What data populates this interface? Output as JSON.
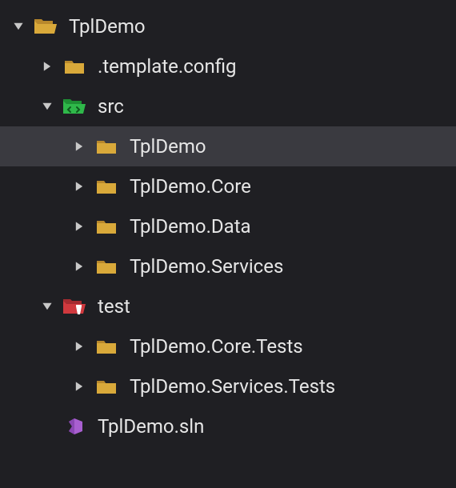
{
  "tree": {
    "root": {
      "label": "TplDemo",
      "icon": "folder-open",
      "expanded": true,
      "children": [
        {
          "label": ".template.config",
          "icon": "folder",
          "expanded": false
        },
        {
          "label": "src",
          "icon": "folder-src",
          "expanded": true,
          "children": [
            {
              "label": "TplDemo",
              "icon": "folder",
              "expanded": false,
              "selected": true
            },
            {
              "label": "TplDemo.Core",
              "icon": "folder",
              "expanded": false
            },
            {
              "label": "TplDemo.Data",
              "icon": "folder",
              "expanded": false
            },
            {
              "label": "TplDemo.Services",
              "icon": "folder",
              "expanded": false
            }
          ]
        },
        {
          "label": "test",
          "icon": "folder-test",
          "expanded": true,
          "children": [
            {
              "label": "TplDemo.Core.Tests",
              "icon": "folder",
              "expanded": false
            },
            {
              "label": "TplDemo.Services.Tests",
              "icon": "folder",
              "expanded": false
            }
          ]
        },
        {
          "label": "TplDemo.sln",
          "icon": "sln"
        }
      ]
    }
  },
  "colors": {
    "folder": "#d9a93a",
    "folderSrc": "#2fb84a",
    "folderTest": "#d0393e",
    "sln": "#a85fd0",
    "arrow": "#c8c8c8",
    "text": "#e6e6e6"
  }
}
